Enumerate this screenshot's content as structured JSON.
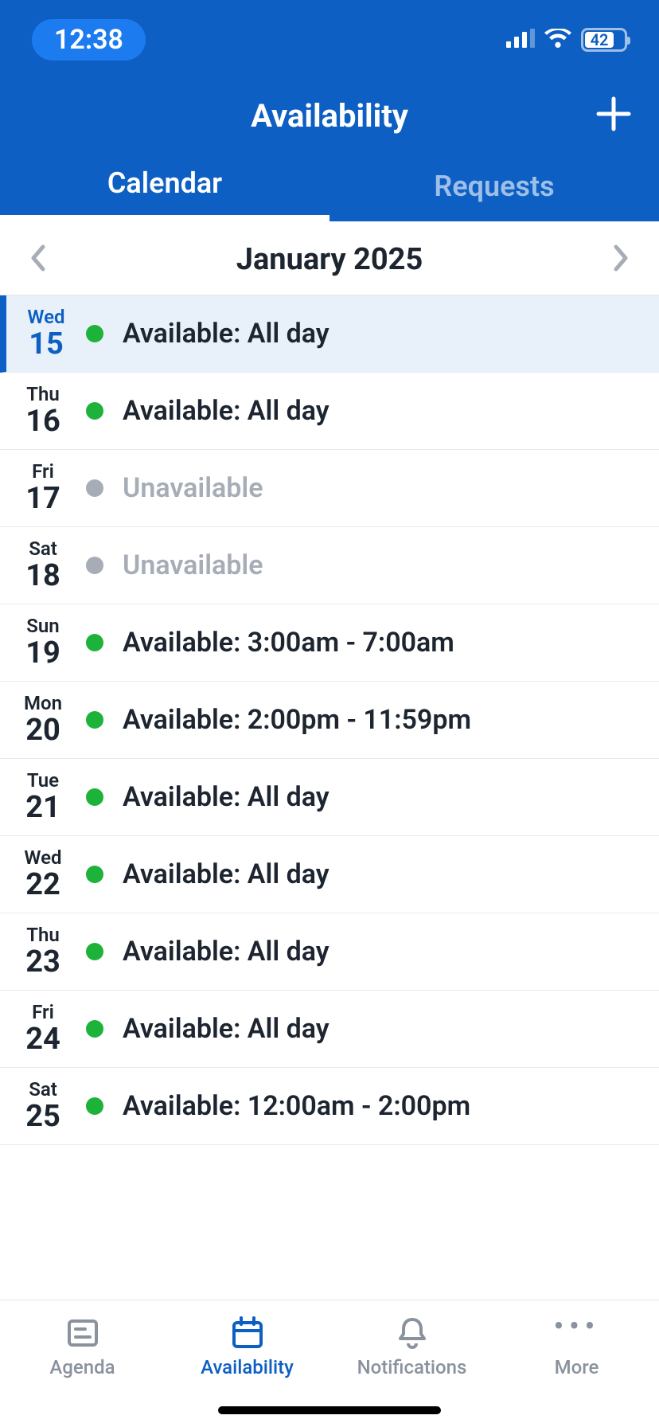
{
  "status_bar": {
    "time": "12:38",
    "battery": "42"
  },
  "header": {
    "title": "Availability"
  },
  "tabs": {
    "calendar": "Calendar",
    "requests": "Requests"
  },
  "month_nav": {
    "label": "January 2025"
  },
  "days": [
    {
      "weekday": "Wed",
      "daynum": "15",
      "status": "Available: All day",
      "available": true,
      "today": true
    },
    {
      "weekday": "Thu",
      "daynum": "16",
      "status": "Available: All day",
      "available": true,
      "today": false
    },
    {
      "weekday": "Fri",
      "daynum": "17",
      "status": "Unavailable",
      "available": false,
      "today": false
    },
    {
      "weekday": "Sat",
      "daynum": "18",
      "status": "Unavailable",
      "available": false,
      "today": false
    },
    {
      "weekday": "Sun",
      "daynum": "19",
      "status": "Available: 3:00am - 7:00am",
      "available": true,
      "today": false
    },
    {
      "weekday": "Mon",
      "daynum": "20",
      "status": "Available: 2:00pm - 11:59pm",
      "available": true,
      "today": false
    },
    {
      "weekday": "Tue",
      "daynum": "21",
      "status": "Available: All day",
      "available": true,
      "today": false
    },
    {
      "weekday": "Wed",
      "daynum": "22",
      "status": "Available: All day",
      "available": true,
      "today": false
    },
    {
      "weekday": "Thu",
      "daynum": "23",
      "status": "Available: All day",
      "available": true,
      "today": false
    },
    {
      "weekday": "Fri",
      "daynum": "24",
      "status": "Available: All day",
      "available": true,
      "today": false
    },
    {
      "weekday": "Sat",
      "daynum": "25",
      "status": "Available: 12:00am - 2:00pm",
      "available": true,
      "today": false
    }
  ],
  "bottom_nav": {
    "agenda": "Agenda",
    "availability": "Availability",
    "notifications": "Notifications",
    "more": "More"
  }
}
